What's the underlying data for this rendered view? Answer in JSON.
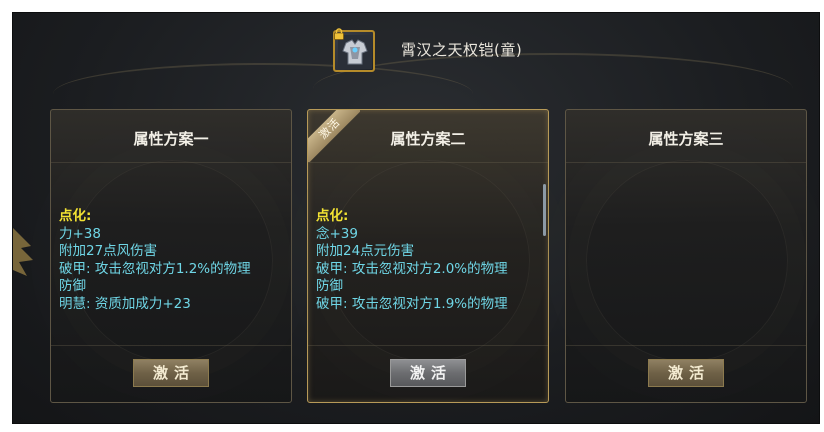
{
  "item": {
    "name": "霄汉之天权铠(童)",
    "icon": "armor-icon",
    "lock": "lock-icon"
  },
  "colors": {
    "head": "#f2e233",
    "attr": "#6fd6e6",
    "gold_border": "#b79a58"
  },
  "cards": [
    {
      "title": "属性方案一",
      "active": false,
      "head": "点化:",
      "lines": [
        "力+38",
        "附加27点风伤害",
        "破甲: 攻击忽视对方1.2%的物理",
        "防御",
        "明慧: 资质加成力+23"
      ],
      "button": "激活"
    },
    {
      "title": "属性方案二",
      "active": true,
      "ribbon": "激活",
      "head": "点化:",
      "lines": [
        "念+39",
        "附加24点元伤害",
        "破甲: 攻击忽视对方2.0%的物理",
        "防御",
        "破甲: 攻击忽视对方1.9%的物理"
      ],
      "button": "激活"
    },
    {
      "title": "属性方案三",
      "active": false,
      "head": "",
      "lines": [],
      "button": "激活"
    }
  ]
}
